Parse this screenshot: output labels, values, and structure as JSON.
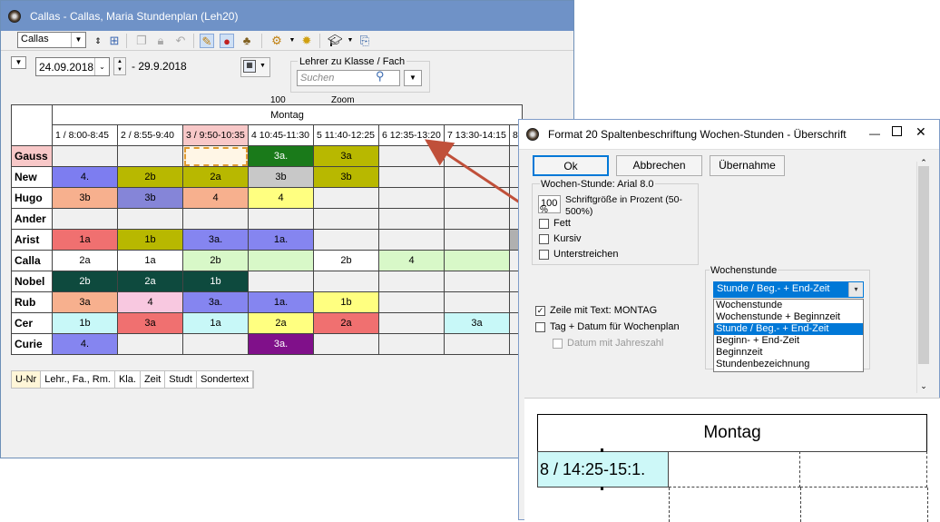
{
  "main_window": {
    "title": "Callas - Callas, Maria  Stundenplan  (Leh20)",
    "element_select": "Callas",
    "date_from": "24.09.2018",
    "date_to": "- 29.9.2018",
    "lookup_label": "Lehrer zu Klasse / Fach",
    "search_placeholder": "Suchen",
    "zoom_partial": "100",
    "zoom_label_partial": "Zoom"
  },
  "grid": {
    "day": "Montag",
    "periods": [
      "1 / 8:00-8:45",
      "2 / 8:55-9:40",
      "3 / 9:50-10:35",
      "4 10:45-11:30",
      "5 11:40-12:25",
      "6 12:35-13:20",
      "7 13:30-14:15",
      "8"
    ],
    "rows": [
      {
        "teacher": "Gauss",
        "cells": [
          [
            "",
            ""
          ],
          [
            "",
            ""
          ],
          [
            "",
            "#fff6e6"
          ],
          [
            "3a.",
            "#1a7a1a"
          ],
          [
            "3a",
            "#b8b800"
          ],
          [
            "",
            ""
          ],
          [
            "",
            ""
          ],
          [
            "",
            ""
          ]
        ]
      },
      {
        "teacher": "New",
        "cells": [
          [
            "4.",
            "#7d7df0"
          ],
          [
            "2b",
            "#b8b800"
          ],
          [
            "2a",
            "#b8b800"
          ],
          [
            "3b",
            "#c8c8c8"
          ],
          [
            "3b",
            "#b8b800"
          ],
          [
            "",
            ""
          ],
          [
            "",
            ""
          ],
          [
            "",
            ""
          ]
        ]
      },
      {
        "teacher": "Hugo",
        "cells": [
          [
            "3b",
            "#f7b08e"
          ],
          [
            "3b",
            "#8585d8"
          ],
          [
            "4",
            "#f7b08e"
          ],
          [
            "4",
            "#ffff80"
          ],
          [
            "",
            ""
          ],
          [
            "",
            ""
          ],
          [
            "",
            ""
          ],
          [
            "",
            ""
          ]
        ]
      },
      {
        "teacher": "Ander",
        "cells": [
          [
            "",
            ""
          ],
          [
            "",
            ""
          ],
          [
            "",
            ""
          ],
          [
            "",
            ""
          ],
          [
            "",
            ""
          ],
          [
            "",
            ""
          ],
          [
            "",
            ""
          ],
          [
            "",
            ""
          ]
        ]
      },
      {
        "teacher": "Arist",
        "cells": [
          [
            "1a",
            "#f07070"
          ],
          [
            "1b",
            "#b8b800"
          ],
          [
            "3a.",
            "#8585f0"
          ],
          [
            "1a.",
            "#8585f0"
          ],
          [
            "",
            ""
          ],
          [
            "",
            ""
          ],
          [
            "",
            ""
          ],
          [
            "",
            "#b0b0b0"
          ]
        ]
      },
      {
        "teacher": "Calla",
        "cells": [
          [
            "2a",
            "#ffffff"
          ],
          [
            "1a",
            "#ffffff"
          ],
          [
            "2b",
            "#d8f8c8"
          ],
          [
            "",
            "#d8f8c8"
          ],
          [
            "2b",
            "#ffffff"
          ],
          [
            "4",
            "#d8f8c8"
          ],
          [
            "",
            "#d8f8c8"
          ],
          [
            "",
            ""
          ]
        ]
      },
      {
        "teacher": "Nobel",
        "cells": [
          [
            "2b",
            "#0e4a3e"
          ],
          [
            "2a",
            "#0e4a3e"
          ],
          [
            "1b",
            "#0e4a3e"
          ],
          [
            "",
            ""
          ],
          [
            "",
            ""
          ],
          [
            "",
            ""
          ],
          [
            "",
            ""
          ],
          [
            "",
            ""
          ]
        ]
      },
      {
        "teacher": "Rub",
        "cells": [
          [
            "3a",
            "#f7b08e"
          ],
          [
            "4",
            "#f8c8e0"
          ],
          [
            "3a.",
            "#8585f0"
          ],
          [
            "1a.",
            "#8585f0"
          ],
          [
            "1b",
            "#ffff80"
          ],
          [
            "",
            ""
          ],
          [
            "",
            ""
          ],
          [
            "",
            ""
          ]
        ]
      },
      {
        "teacher": "Cer",
        "cells": [
          [
            "1b",
            "#c8f8f8"
          ],
          [
            "3a",
            "#f07070"
          ],
          [
            "1a",
            "#c8f8f8"
          ],
          [
            "2a",
            "#ffff80"
          ],
          [
            "2a",
            "#f07070"
          ],
          [
            "",
            ""
          ],
          [
            "3a",
            "#c8f8f8"
          ],
          [
            "",
            ""
          ]
        ]
      },
      {
        "teacher": "Curie",
        "cells": [
          [
            "4.",
            "#8585f0"
          ],
          [
            "",
            ""
          ],
          [
            "",
            ""
          ],
          [
            "3a.",
            "#80108a"
          ],
          [
            "",
            ""
          ],
          [
            "",
            ""
          ],
          [
            "",
            ""
          ],
          [
            "",
            ""
          ]
        ]
      }
    ]
  },
  "bottom_tabs": [
    "U-Nr",
    "Lehr., Fa., Rm.",
    "Kla.",
    "Zeit",
    "Studt",
    "Sondertext"
  ],
  "dialog": {
    "title": "Format 20  Spaltenbeschriftung  Wochen-Stunden - Überschrift",
    "ok": "Ok",
    "cancel": "Abbrechen",
    "apply": "Übernahme",
    "font_group": "Wochen-Stunde: Arial 8.0",
    "size_value": "100",
    "size_unit": "%",
    "size_desc": "Schriftgröße in Prozent (50-500%)",
    "bold": "Fett",
    "italic": "Kursiv",
    "underline": "Unterstreichen",
    "week_hour_label": "Wochenstunde",
    "combo_value": "Stunde / Beg.- + End-Zeit",
    "options": [
      "Wochenstunde",
      "Wochenstunde + Beginnzeit",
      "Stunde / Beg.- + End-Zeit",
      "Beginn- + End-Zeit",
      "Beginnzeit",
      "Stundenbezeichnung"
    ],
    "row_text": "Zeile mit Text: MONTAG",
    "day_date": "Tag + Datum für Wochenplan",
    "date_year": "Datum mit Jahreszahl",
    "preview_day": "Montag",
    "preview_cell": "8 / 14:25-15:1."
  },
  "colors": {
    "title_bar": "#6f92c7",
    "arrow": "#c0503a",
    "selection": "#0078d7"
  }
}
